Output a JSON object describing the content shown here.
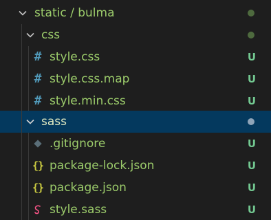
{
  "tree": {
    "root": {
      "name_left": "static",
      "separator": "/",
      "name_right": "bulma",
      "expanded": true,
      "decoration": "modified-dot"
    },
    "css_folder": {
      "name": "css",
      "expanded": true,
      "decoration": "modified-dot"
    },
    "css_files": [
      {
        "name": "style.css",
        "icon": "css-hash-icon",
        "badge": "U"
      },
      {
        "name": "style.css.map",
        "icon": "css-hash-icon",
        "badge": "U"
      },
      {
        "name": "style.min.css",
        "icon": "css-hash-icon",
        "badge": "U"
      }
    ],
    "sass_folder": {
      "name": "sass",
      "expanded": true,
      "selected": true,
      "decoration": "modified-dot"
    },
    "sass_files": [
      {
        "name": ".gitignore",
        "icon": "git-icon",
        "badge": "U"
      },
      {
        "name": "package-lock.json",
        "icon": "json-braces",
        "glyph": "{}",
        "badge": "U"
      },
      {
        "name": "package.json",
        "icon": "json-braces",
        "glyph": "{}",
        "badge": "U"
      },
      {
        "name": "style.sass",
        "icon": "sass-icon",
        "badge": "U"
      }
    ]
  },
  "colors": {
    "background": "#1e1e1e",
    "selection": "#04395e",
    "untracked_text": "#9ccc6b",
    "untracked_badge": "#73c991",
    "css_icon": "#519aba",
    "json_icon": "#cbcb41",
    "sass_icon": "#f55385"
  }
}
